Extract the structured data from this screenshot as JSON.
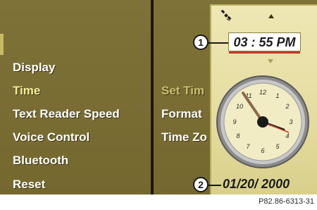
{
  "menu": {
    "items": [
      {
        "label": "Display",
        "active": false
      },
      {
        "label": "Time",
        "active": true
      },
      {
        "label": "Text Reader Speed",
        "active": false
      },
      {
        "label": "Voice Control",
        "active": false
      },
      {
        "label": "Bluetooth",
        "active": false
      },
      {
        "label": "Reset",
        "active": false
      }
    ]
  },
  "submenu": {
    "items": [
      {
        "label": "Set Tim",
        "active": true
      },
      {
        "label": "Format",
        "active": false
      },
      {
        "label": "Time Zo",
        "active": false
      }
    ]
  },
  "clock_panel": {
    "time": "03 : 55 PM",
    "date": "01/20/ 2000",
    "callout_time": "1",
    "callout_date": "2",
    "dial_numbers": [
      "12",
      "1",
      "2",
      "3",
      "4",
      "5",
      "6",
      "7",
      "8",
      "9",
      "10",
      "11"
    ]
  },
  "colors": {
    "screen_bg": "#7a6d34",
    "panel_bg": "#e5dca0",
    "highlight_text": "#f7ee9a",
    "time_underline": "#c23a2a"
  },
  "icons": [
    "satellite-icon",
    "arrow-up-icon",
    "arrow-down-icon"
  ],
  "caption": "P82.86-6313-31"
}
